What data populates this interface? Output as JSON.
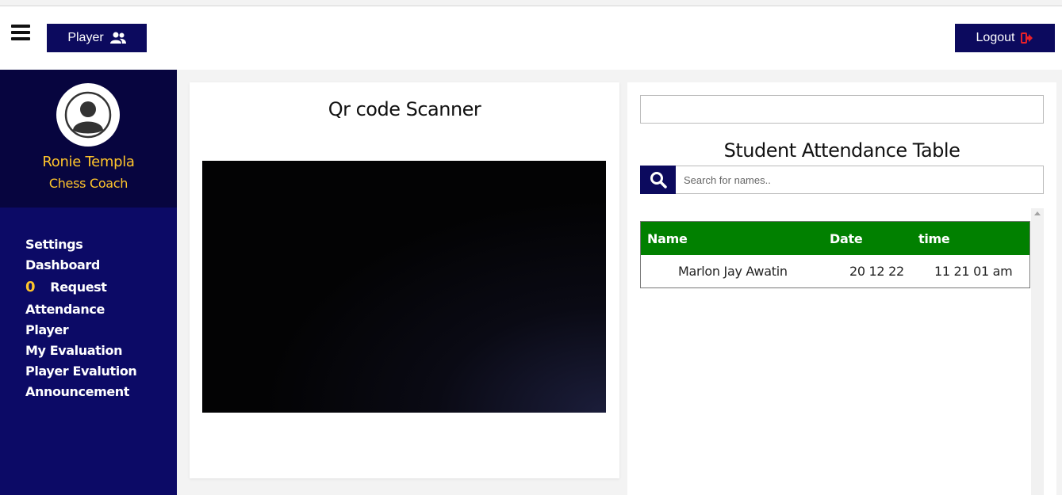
{
  "header": {
    "player_label": "Player",
    "logout_label": "Logout"
  },
  "profile": {
    "name": "Ronie Templa",
    "role": "Chess Coach"
  },
  "sidebar": {
    "items": [
      {
        "label": "Settings"
      },
      {
        "label": "Dashboard"
      },
      {
        "label": "Request",
        "count": "0"
      },
      {
        "label": "Attendance"
      },
      {
        "label": "Player"
      },
      {
        "label": "My Evaluation"
      },
      {
        "label": "Player Evalution"
      },
      {
        "label": "Announcement"
      }
    ]
  },
  "scanner": {
    "title": "Qr code Scanner"
  },
  "attendance": {
    "title": "Student Attendance Table",
    "top_input_value": "",
    "search_placeholder": "Search for names..",
    "columns": [
      "Name",
      "Date",
      "time"
    ],
    "rows": [
      {
        "name": "Marlon Jay Awatin",
        "date": "20 12 22",
        "time": "11 21 01 am"
      }
    ]
  },
  "colors": {
    "navy": "#0c0a5e",
    "sidebar": "#0c0a66",
    "profile_bg": "#07053f",
    "accent_yellow": "#ffc52b",
    "table_header_green": "#018000",
    "logout_icon": "#e8202a"
  }
}
